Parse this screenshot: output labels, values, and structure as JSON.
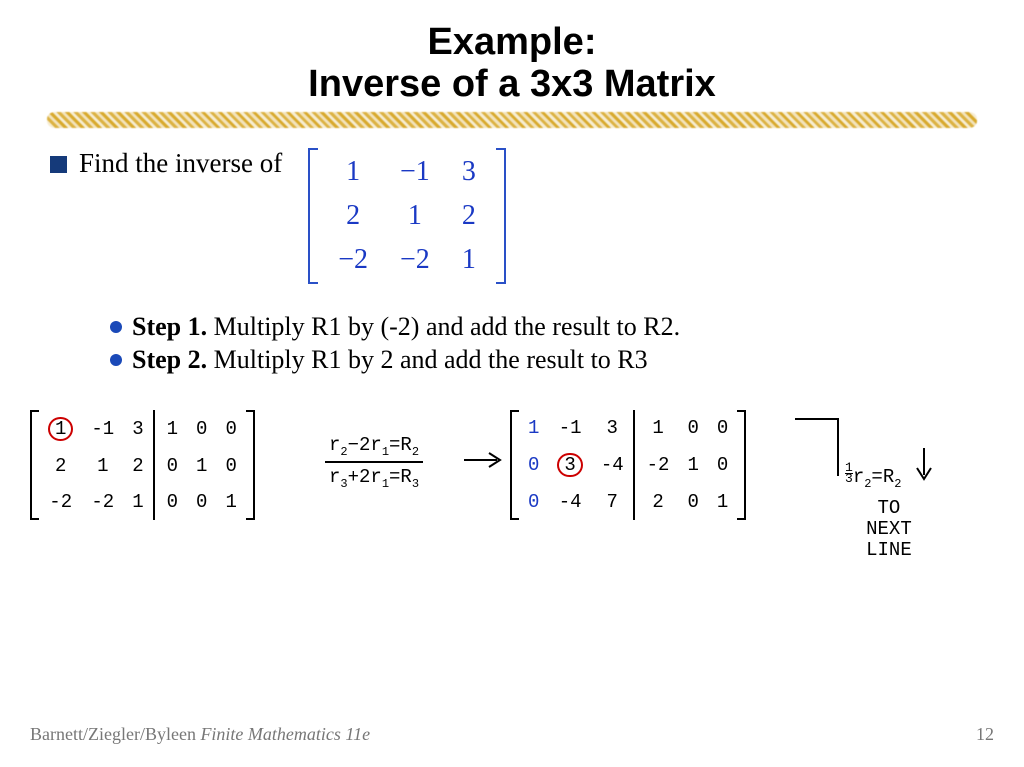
{
  "title": {
    "line1": "Example:",
    "line2": "Inverse of a 3x3 Matrix"
  },
  "bullet": {
    "find": "Find the inverse of"
  },
  "matrix": {
    "r1c1": "1",
    "r1c2": "−1",
    "r1c3": "3",
    "r2c1": "2",
    "r2c2": "1",
    "r2c3": "2",
    "r3c1": "−2",
    "r3c2": "−2",
    "r3c3": "1"
  },
  "steps": {
    "s1_label": "Step 1.",
    "s1_text": " Multiply R1 by (-2) and add the result to R2.",
    "s2_label": "Step 2.",
    "s2_text": " Multiply R1 by 2 and add the result to R3"
  },
  "aug1": {
    "a11": "1",
    "a12": "-1",
    "a13": "3",
    "b11": "1",
    "b12": "0",
    "b13": "0",
    "a21": "2",
    "a22": "1",
    "a23": "2",
    "b21": "0",
    "b22": "1",
    "b23": "0",
    "a31": "-2",
    "a32": "-2",
    "a33": "1",
    "b31": "0",
    "b32": "0",
    "b33": "1"
  },
  "ops": {
    "top_a": "r",
    "top_as": "2",
    "top_b": "−2r",
    "top_bs": "1",
    "top_c": "=R",
    "top_cs": "2",
    "bot_a": "r",
    "bot_as": "3",
    "bot_b": "+2r",
    "bot_bs": "1",
    "bot_c": "=R",
    "bot_cs": "3"
  },
  "aug2": {
    "a11": "1",
    "a12": "-1",
    "a13": "3",
    "b11": "1",
    "b12": "0",
    "b13": "0",
    "a21": "0",
    "a22": "3",
    "a23": "-4",
    "b21": "-2",
    "b22": "1",
    "b23": "0",
    "a31": "0",
    "a32": "-4",
    "a33": "7",
    "b31": "2",
    "b32": "0",
    "b33": "1"
  },
  "right": {
    "frac_num": "1",
    "frac_den": "3",
    "expr_a": "r",
    "expr_as": "2",
    "expr_b": "=R",
    "expr_bs": "2",
    "to": "TO",
    "next": "NEXT",
    "line": "LINE"
  },
  "footer": {
    "authors": "Barnett/Ziegler/Byleen ",
    "book": "Finite Mathematics 11e",
    "page": "12"
  }
}
